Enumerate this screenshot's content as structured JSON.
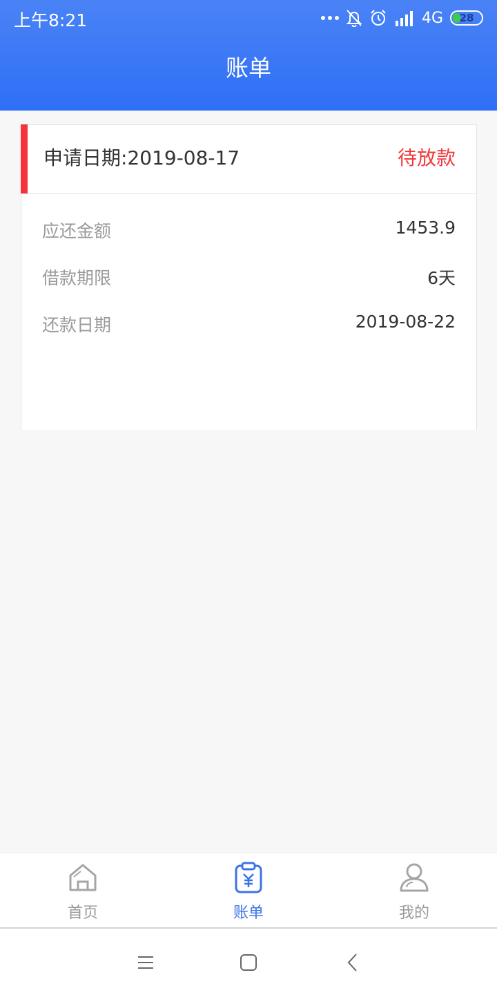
{
  "status_bar": {
    "time": "上午8:21",
    "network": "4G",
    "battery": "28",
    "battery_level": 0.28,
    "icons": [
      "more-dots-icon",
      "bell-off-icon",
      "alarm-icon",
      "signal-icon",
      "battery-icon"
    ]
  },
  "header": {
    "title": "账单"
  },
  "bill": {
    "apply_date": "申请日期:2019-08-17",
    "status": "待放款",
    "rows": [
      {
        "label": "应还金额",
        "value": "1453.9"
      },
      {
        "label": "借款期限",
        "value": "6天"
      },
      {
        "label": "还款日期",
        "value": "2019-08-22"
      }
    ]
  },
  "tabs": [
    {
      "label": "首页",
      "icon": "home-icon",
      "active": false
    },
    {
      "label": "账单",
      "icon": "bill-icon",
      "active": true
    },
    {
      "label": "我的",
      "icon": "profile-icon",
      "active": false
    }
  ],
  "system_nav": [
    "menu-icon",
    "home-square-icon",
    "back-icon"
  ],
  "colors": {
    "header_top": "#4a83f6",
    "header_bottom": "#2f6ff7",
    "accent_red": "#f5333a",
    "status_red": "#f0393d",
    "tab_active": "#3b73e6",
    "tab_inactive": "#999999",
    "battery_green": "#3ec94f"
  }
}
